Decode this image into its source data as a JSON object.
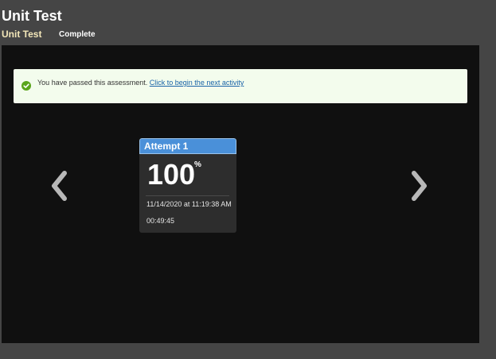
{
  "page": {
    "title": "Unit Test",
    "subtitle": "Unit Test",
    "status": "Complete"
  },
  "notice": {
    "icon": "check-circle-icon",
    "message": "You have passed this assessment.",
    "link_text": "Click to begin the next activity"
  },
  "navigation": {
    "prev_icon": "chevron-left-icon",
    "next_icon": "chevron-right-icon"
  },
  "attempt": {
    "label": "Attempt 1",
    "score": "100",
    "score_unit": "%",
    "score_fraction": 1.0,
    "date": "11/14/2020 at 11:19:38 AM",
    "duration": "00:49:45"
  },
  "colors": {
    "background": "#454545",
    "stage": "#101010",
    "notice_bg": "#f3fced",
    "success": "#5aa51b",
    "link": "#1a63a8",
    "card_header": "#4a90d9",
    "card_body": "#2d2d2d",
    "subtitle": "#f3e7b9"
  }
}
